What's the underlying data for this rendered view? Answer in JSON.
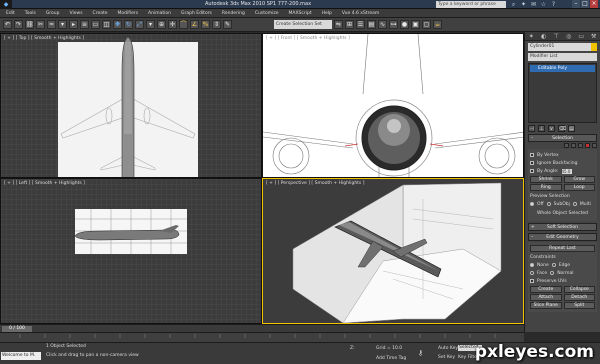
{
  "window": {
    "title": "Autodesk 3ds Max  2010 SP1       777-200.max",
    "search_placeholder": "Type a keyword or phrase"
  },
  "menu": [
    "Edit",
    "Tools",
    "Group",
    "Views",
    "Create",
    "Modifiers",
    "Animation",
    "Graph Editors",
    "Rendering",
    "Customize",
    "MAXScript",
    "Help",
    "Vue 4.6 xStream"
  ],
  "toolbar": {
    "selection_set_placeholder": "Create Selection Set"
  },
  "viewports": {
    "top": {
      "label": "[ + ] [ Top ] [ Smooth + Highlights ]"
    },
    "front": {
      "label": "[ + ] [ Front ] [ Smooth + Highlights ]"
    },
    "left": {
      "label": "[ + ] [ Left ] [ Smooth + Highlights ]"
    },
    "perspective": {
      "label": "[ + ] [ Perspective ] [ Smooth + Highlights ]"
    }
  },
  "panel": {
    "object_name": "Cylinder01",
    "modifier_list": "Modifier List",
    "stack_item": "Editable Poly",
    "selection": {
      "title": "Selection",
      "by_vertex": "By Vertex",
      "ignore_backfacing": "Ignore Backfacing",
      "by_angle": "By Angle:",
      "by_angle_value": "45.0",
      "shrink": "Shrink",
      "grow": "Grow",
      "ring": "Ring",
      "loop": "Loop",
      "preview_selection": "Preview Selection",
      "off": "Off",
      "subobj": "SubObj",
      "multi": "Multi",
      "status": "Whole Object Selected"
    },
    "soft_selection": "Soft Selection",
    "edit_geometry": {
      "title": "Edit Geometry",
      "repeat_last": "Repeat Last",
      "constraints": "Constraints",
      "none": "None",
      "edge": "Edge",
      "face": "Face",
      "normal": "Normal",
      "preserve_uvs": "Preserve UVs",
      "create": "Create",
      "collapse": "Collapse",
      "attach": "Attach",
      "detach": "Detach",
      "slice_plane": "Slice Plane",
      "split": "Split"
    }
  },
  "timeline": {
    "frame_label": "0 / 100"
  },
  "status": {
    "maxscript_text": "Welcome to M.",
    "selected": "1 Object Selected",
    "prompt": "Click and drag to pan a non-camera view",
    "z_label": "Z:",
    "grid": "Grid = 10.0",
    "auto_key": "Auto Key",
    "set_key": "Set Key",
    "selected_field": "Selected",
    "key_filters": "Key Filters...",
    "add_time_tag": "Add Time Tag"
  },
  "watermark": "pxleyes.com",
  "colors": {
    "active_viewport": "#f2c200",
    "stack_highlight": "#2f6bb0"
  }
}
